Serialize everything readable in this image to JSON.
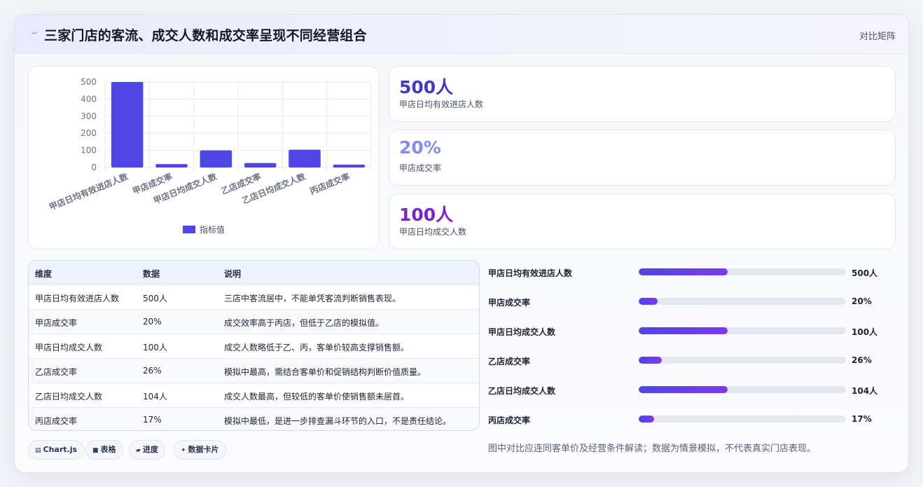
{
  "header": {
    "title": "三家门店的客流、成交人数和成交率呈现不同经营组合",
    "tag": "对比矩阵",
    "icon": "lightning-icon"
  },
  "chart_data": {
    "type": "bar",
    "categories": [
      "甲店日均有效进店人数",
      "甲店成交率",
      "甲店日均成交人数",
      "乙店成交率",
      "乙店日均成交人数",
      "丙店成交率"
    ],
    "series": [
      {
        "name": "指标值",
        "values": [
          500,
          20,
          100,
          26,
          104,
          17
        ],
        "color": "#4f46e5"
      }
    ],
    "ylim": [
      0,
      500
    ],
    "yticks": [
      0,
      100,
      200,
      300,
      400,
      500
    ],
    "legend": "bottom",
    "grid": true
  },
  "stats": [
    {
      "value": "500人",
      "label": "甲店日均有效进店人数",
      "color": "#4338ca"
    },
    {
      "value": "20%",
      "label": "甲店成交率",
      "color": "#818cf8"
    },
    {
      "value": "100人",
      "label": "甲店日均成交人数",
      "color": "#7e22ce"
    }
  ],
  "table": {
    "headers": [
      "维度",
      "数据",
      "说明"
    ],
    "rows": [
      [
        "甲店日均有效进店人数",
        "500人",
        "三店中客流居中，不能单凭客流判断销售表现。"
      ],
      [
        "甲店成交率",
        "20%",
        "成交效率高于丙店，但低于乙店的模拟值。"
      ],
      [
        "甲店日均成交人数",
        "100人",
        "成交人数略低于乙、丙，客单价较高支撑销售额。"
      ],
      [
        "乙店成交率",
        "26%",
        "模拟中最高，需结合客单价和促销结构判断价值质量。"
      ],
      [
        "乙店日均成交人数",
        "104人",
        "成交人数最高，但较低的客单价使销售额未居首。"
      ],
      [
        "丙店成交率",
        "17%",
        "模拟中最低，是进一步排查漏斗环节的入口，不是责任结论。"
      ]
    ]
  },
  "chips": [
    {
      "icon": "chart-icon",
      "glyph": "▤",
      "label": "Chart.js"
    },
    {
      "icon": "table-icon",
      "glyph": "■",
      "label": "表格"
    },
    {
      "icon": "folder-icon",
      "glyph": "▰",
      "label": "进度"
    },
    {
      "icon": "sparkle-icon",
      "glyph": "✦",
      "label": "数据卡片"
    }
  ],
  "progress": [
    {
      "label": "甲店日均有效进店人数",
      "value": "500人",
      "fraction": 0.43
    },
    {
      "label": "甲店成交率",
      "value": "20%",
      "fraction": 0.09
    },
    {
      "label": "甲店日均成交人数",
      "value": "100人",
      "fraction": 0.43
    },
    {
      "label": "乙店成交率",
      "value": "26%",
      "fraction": 0.11
    },
    {
      "label": "乙店日均成交人数",
      "value": "104人",
      "fraction": 0.43
    },
    {
      "label": "丙店成交率",
      "value": "17%",
      "fraction": 0.075
    }
  ],
  "footnote": "图中对比应连同客单价及经营条件解读；数据为情景模拟，不代表真实门店表现。"
}
